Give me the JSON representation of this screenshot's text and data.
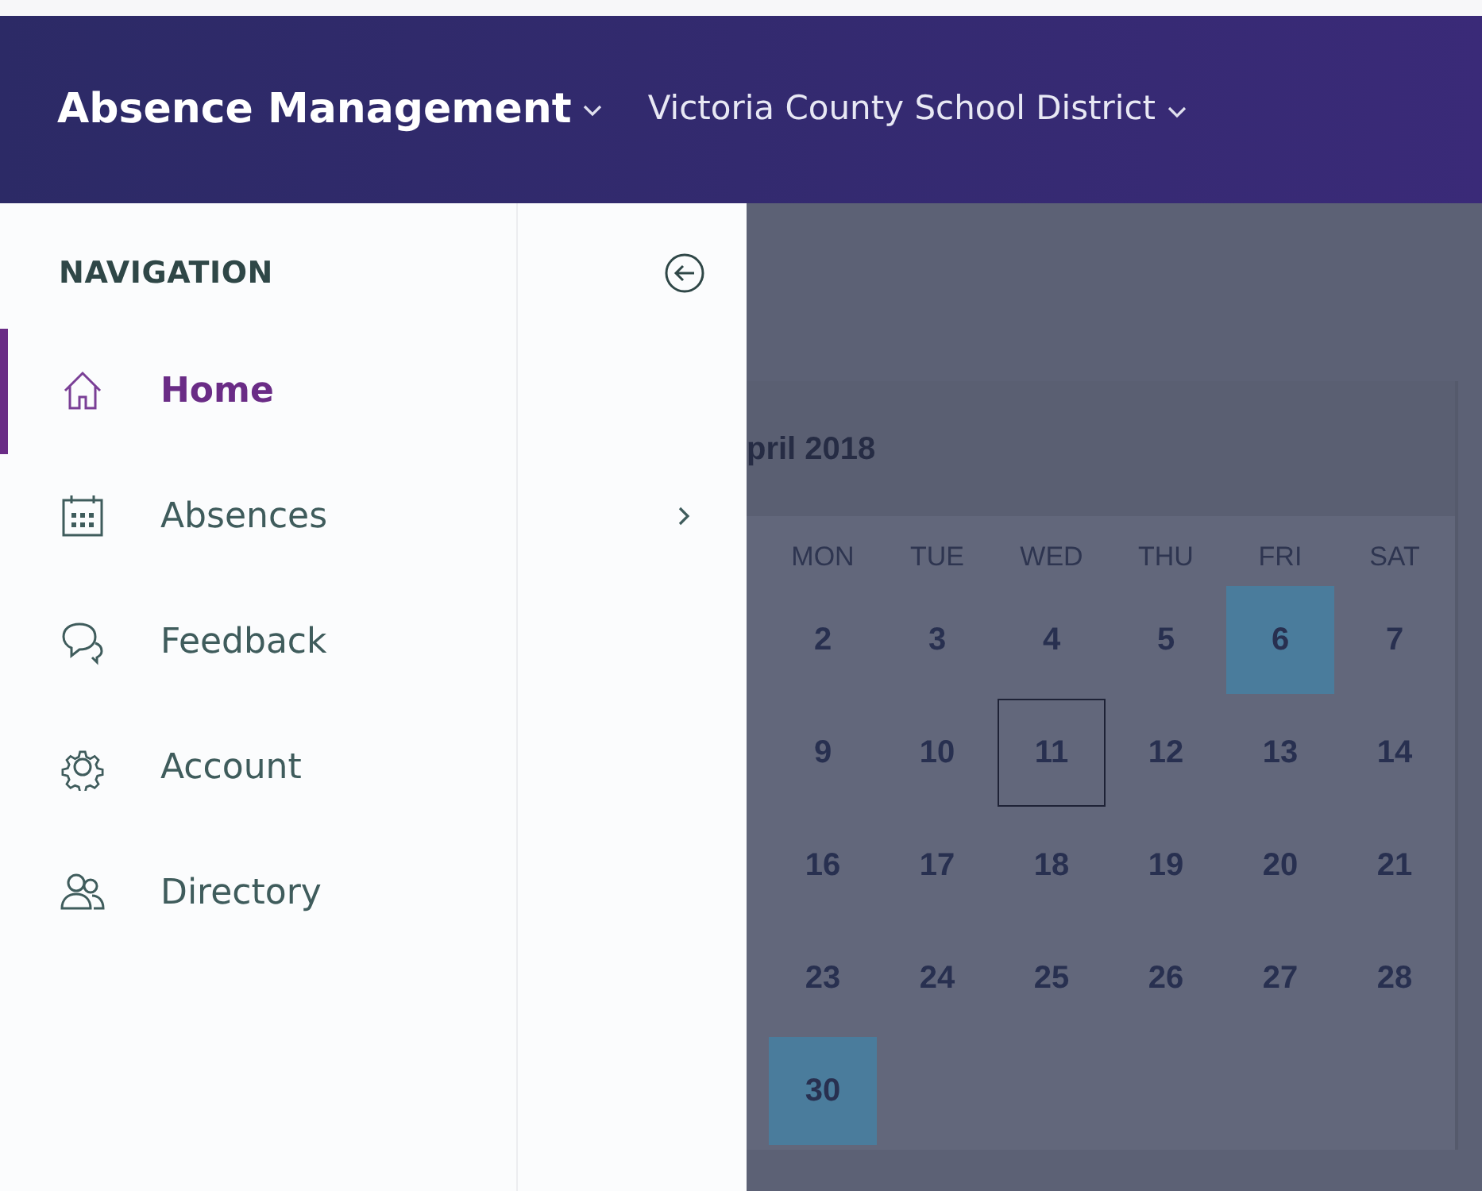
{
  "app_bar": {
    "title": "Absence Management",
    "district": "Victoria County School District"
  },
  "sidebar": {
    "heading": "NAVIGATION",
    "items": [
      {
        "label": "Home",
        "kind": "home",
        "selected": true,
        "has_submenu": false
      },
      {
        "label": "Absences",
        "kind": "calendar",
        "selected": false,
        "has_submenu": true
      },
      {
        "label": "Feedback",
        "kind": "chat",
        "selected": false,
        "has_submenu": false
      },
      {
        "label": "Account",
        "kind": "gear",
        "selected": false,
        "has_submenu": false
      },
      {
        "label": "Directory",
        "kind": "people",
        "selected": false,
        "has_submenu": false
      }
    ]
  },
  "calendar": {
    "month_title": "pril 2018",
    "weekdays": [
      "MON",
      "TUE",
      "WED",
      "THU",
      "FRI",
      "SAT"
    ],
    "weeks": [
      [
        {
          "day": "2",
          "highlighted": false,
          "today": false
        },
        {
          "day": "3",
          "highlighted": false,
          "today": false
        },
        {
          "day": "4",
          "highlighted": false,
          "today": false
        },
        {
          "day": "5",
          "highlighted": false,
          "today": false
        },
        {
          "day": "6",
          "highlighted": true,
          "today": false
        },
        {
          "day": "7",
          "highlighted": false,
          "today": false
        }
      ],
      [
        {
          "day": "9",
          "highlighted": false,
          "today": false
        },
        {
          "day": "10",
          "highlighted": false,
          "today": false
        },
        {
          "day": "11",
          "highlighted": false,
          "today": true
        },
        {
          "day": "12",
          "highlighted": false,
          "today": false
        },
        {
          "day": "13",
          "highlighted": false,
          "today": false
        },
        {
          "day": "14",
          "highlighted": false,
          "today": false
        }
      ],
      [
        {
          "day": "16",
          "highlighted": false,
          "today": false
        },
        {
          "day": "17",
          "highlighted": false,
          "today": false
        },
        {
          "day": "18",
          "highlighted": false,
          "today": false
        },
        {
          "day": "19",
          "highlighted": false,
          "today": false
        },
        {
          "day": "20",
          "highlighted": false,
          "today": false
        },
        {
          "day": "21",
          "highlighted": false,
          "today": false
        }
      ],
      [
        {
          "day": "23",
          "highlighted": false,
          "today": false
        },
        {
          "day": "24",
          "highlighted": false,
          "today": false
        },
        {
          "day": "25",
          "highlighted": false,
          "today": false
        },
        {
          "day": "26",
          "highlighted": false,
          "today": false
        },
        {
          "day": "27",
          "highlighted": false,
          "today": false
        },
        {
          "day": "28",
          "highlighted": false,
          "today": false
        }
      ],
      [
        {
          "day": "30",
          "highlighted": true,
          "today": false
        }
      ]
    ]
  }
}
